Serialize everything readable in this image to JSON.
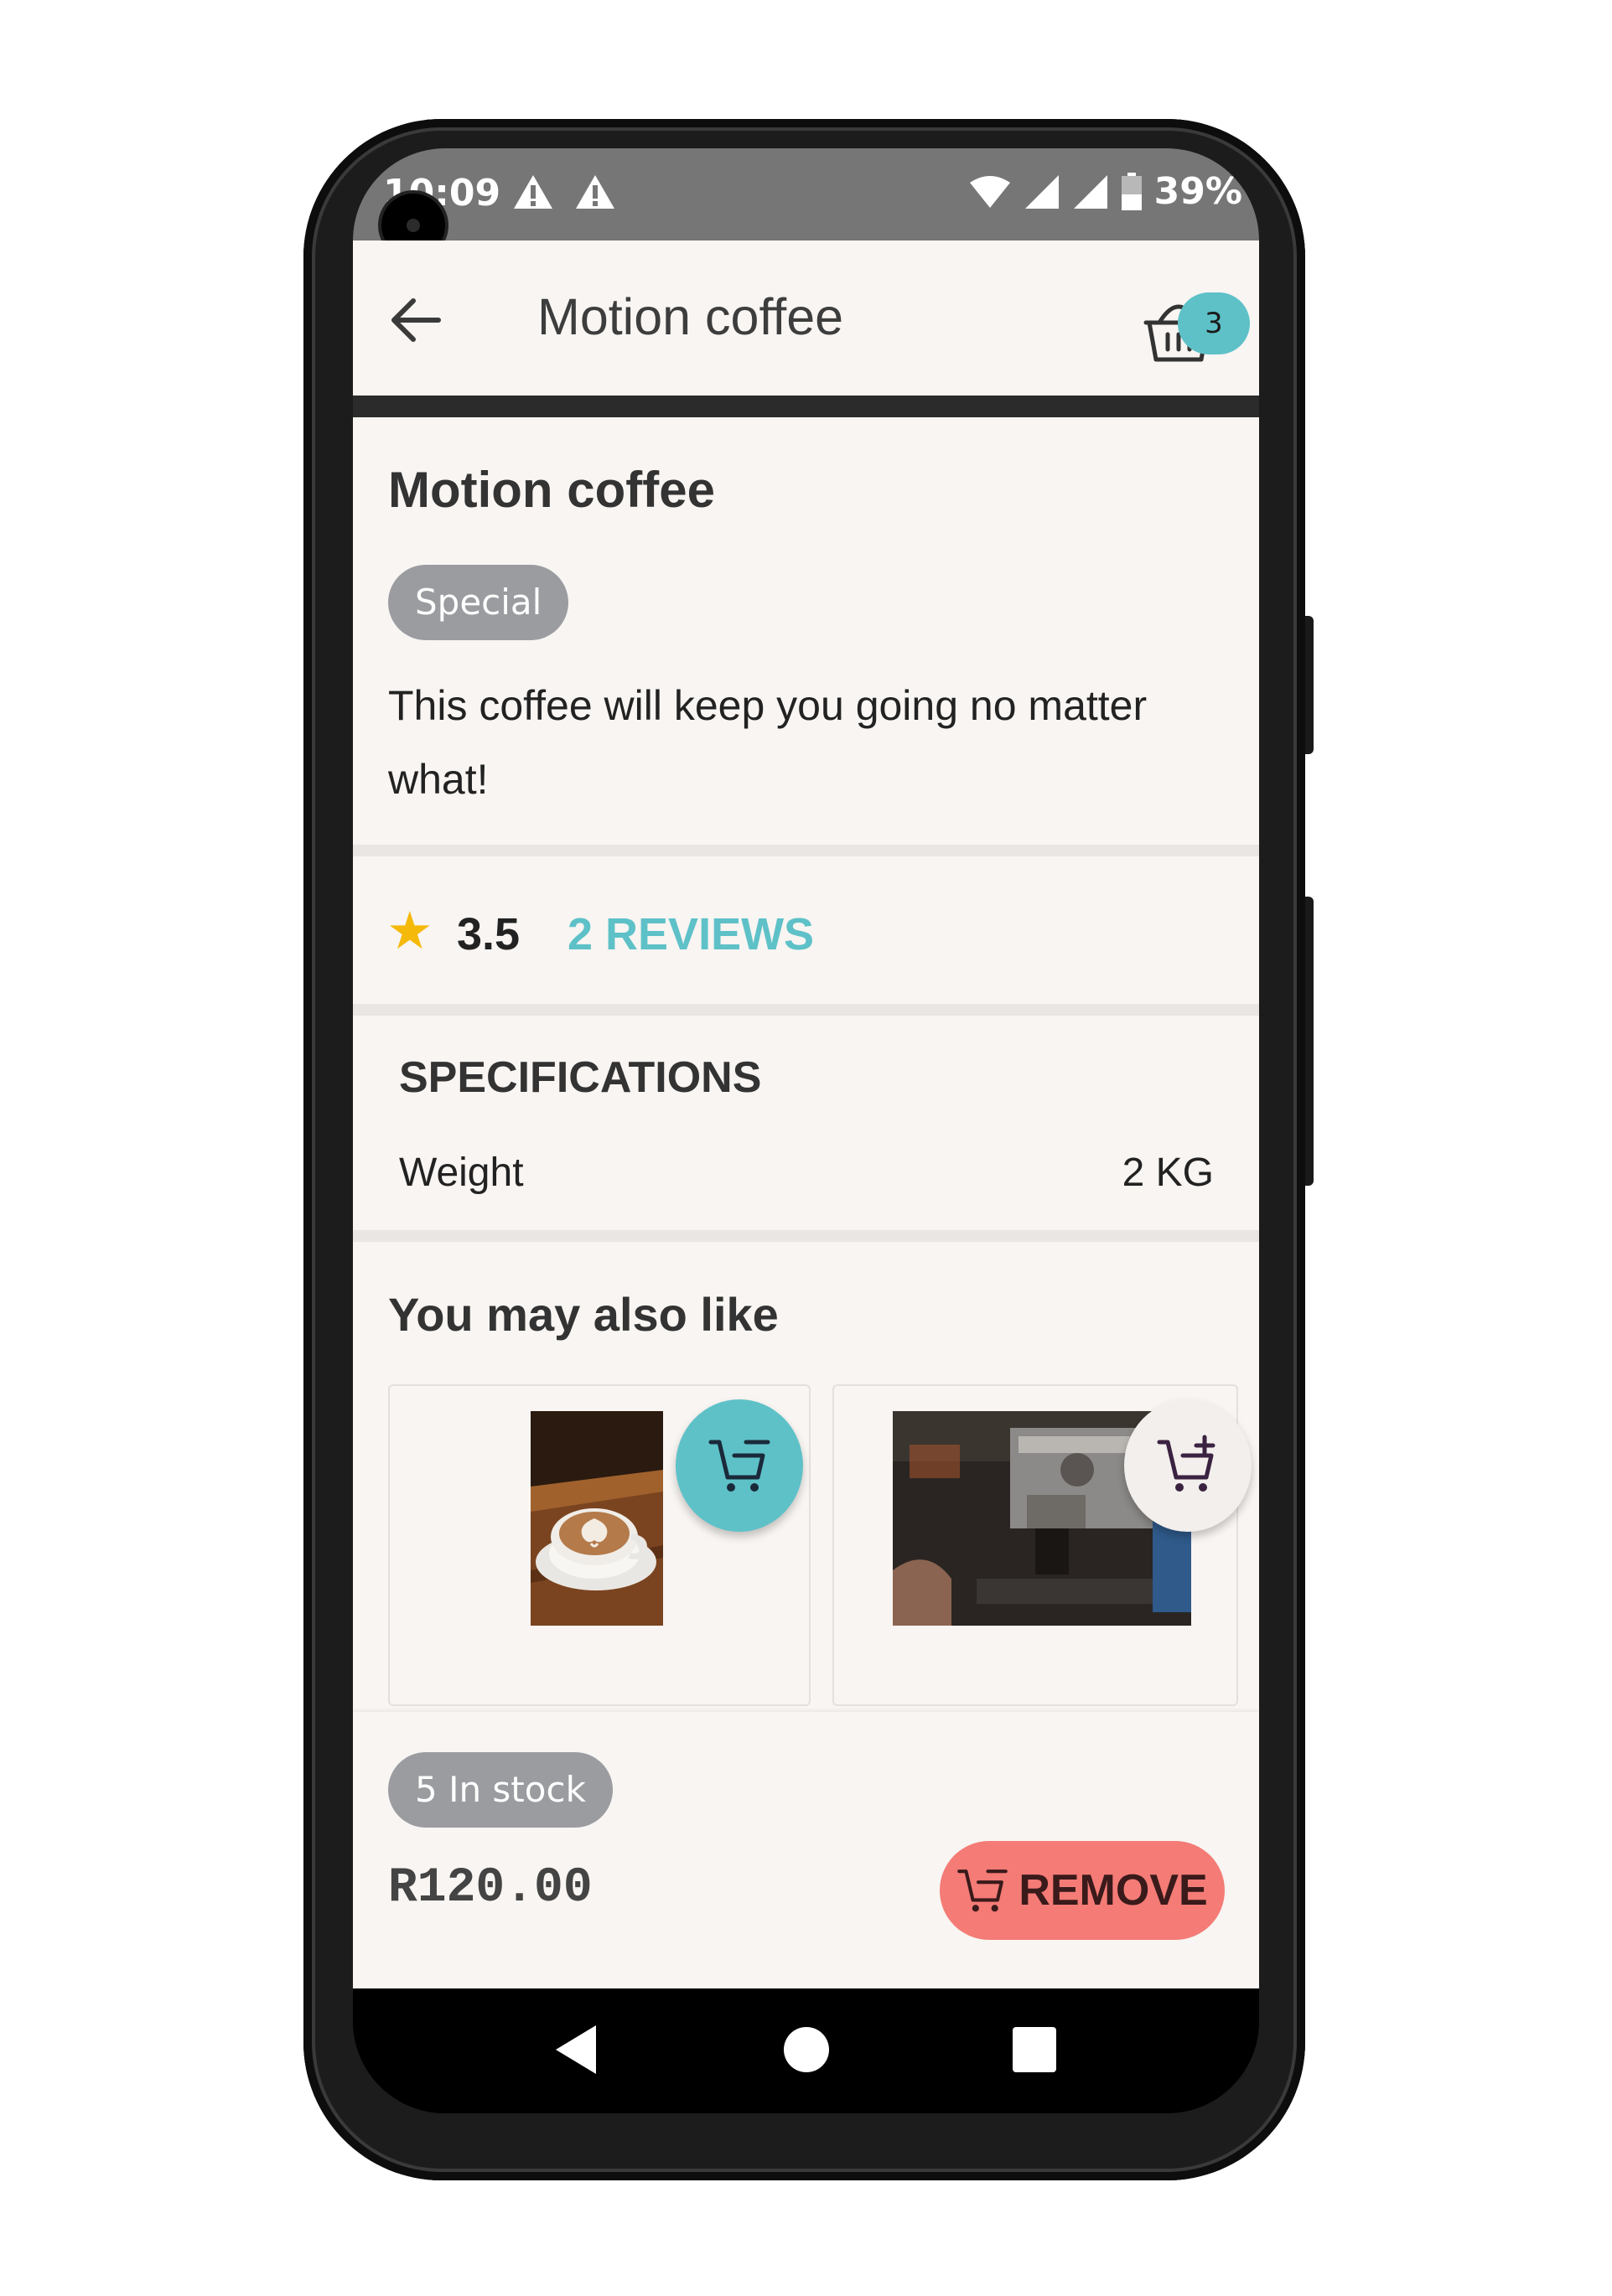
{
  "status_bar": {
    "time": "10:09",
    "battery": "39%"
  },
  "app_bar": {
    "title": "Motion coffee",
    "cart_count": "3"
  },
  "product": {
    "name": "Motion coffee",
    "tag": "Special",
    "description": "This coffee will keep you going no matter what!"
  },
  "rating": {
    "value": "3.5",
    "reviews_label": "2 REVIEWS"
  },
  "specifications": {
    "title": "SPECIFICATIONS",
    "rows": [
      {
        "label": "Weight",
        "value": "2 KG"
      }
    ]
  },
  "suggestions": {
    "title": "You may also like"
  },
  "footer": {
    "stock": "5 In stock",
    "price": "R120.00",
    "remove_label": "REMOVE"
  },
  "colors": {
    "accent": "#5ec1c8",
    "remove": "#f47b76",
    "star": "#f5b90a",
    "chip": "#9a9ca0"
  }
}
